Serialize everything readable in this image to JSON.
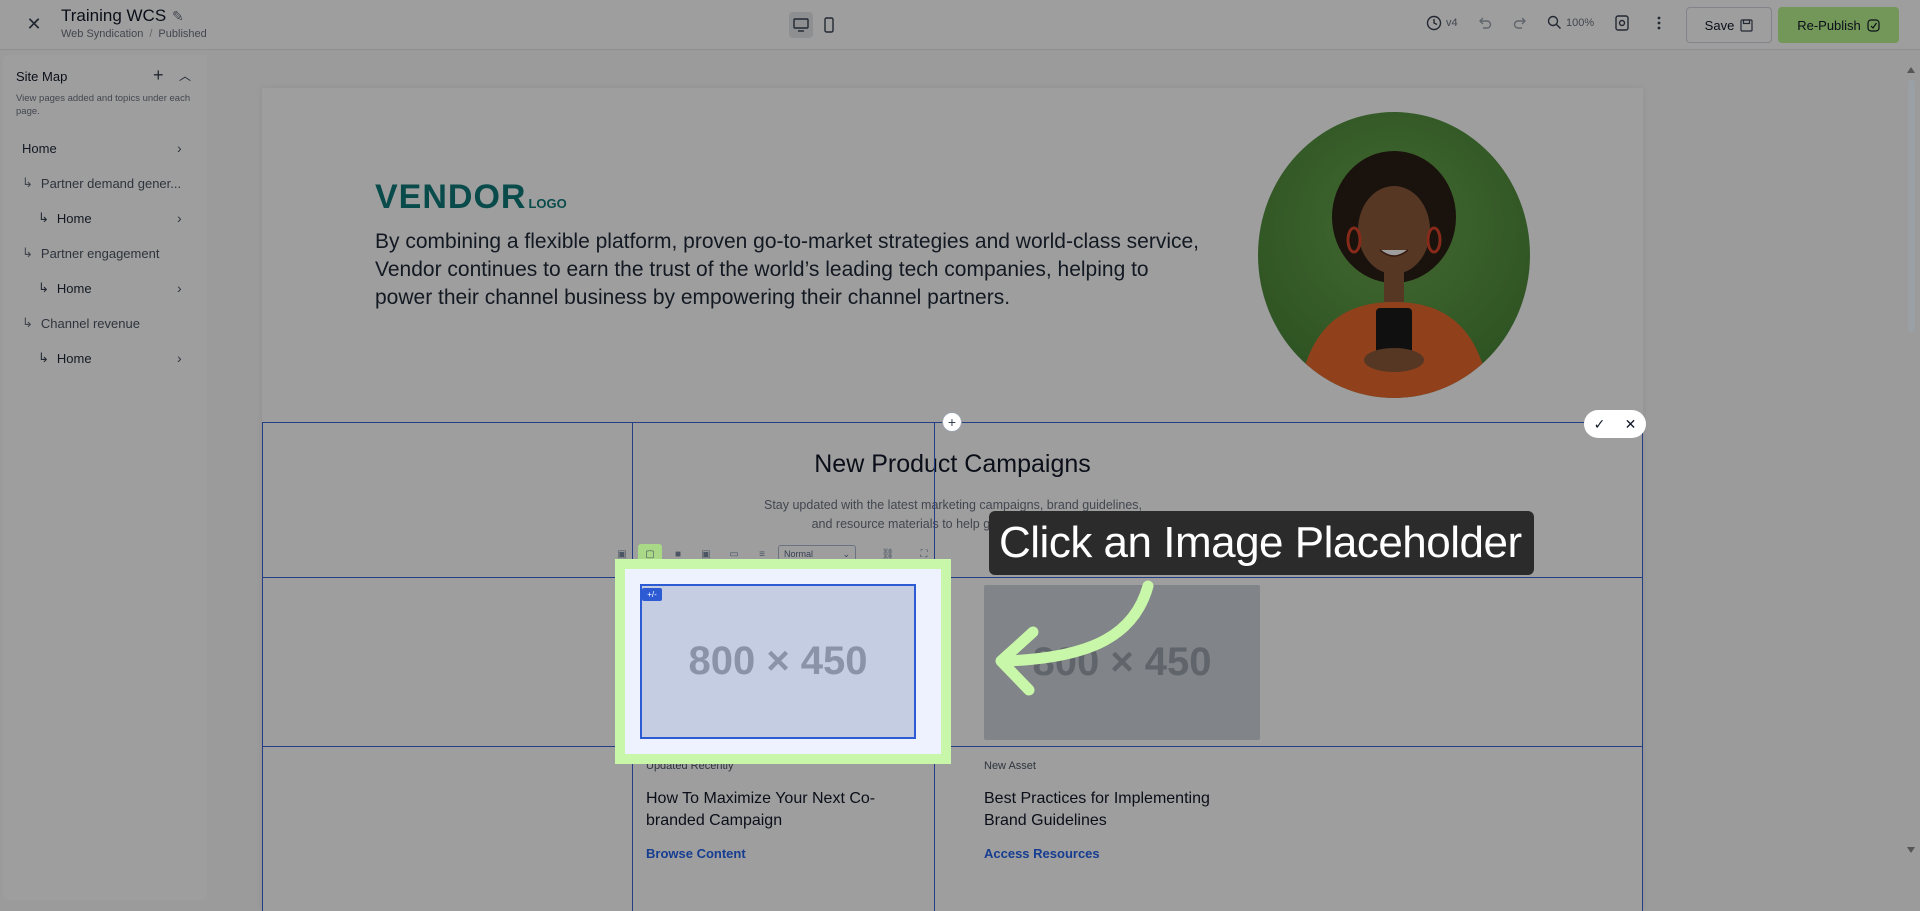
{
  "header": {
    "title": "Training WCS",
    "breadcrumb": [
      "Web Syndication",
      "Published"
    ],
    "version": "v4",
    "zoom": "100%",
    "save_label": "Save",
    "publish_label": "Re-Publish"
  },
  "sidebar": {
    "title": "Site Map",
    "description": "View pages added and topics under each page.",
    "items": [
      {
        "label": "Home",
        "level": 0,
        "arrow": true
      },
      {
        "label": "Partner demand gener...",
        "level": 1,
        "arrow": false
      },
      {
        "label": "Home",
        "level": 2,
        "arrow": true
      },
      {
        "label": "Partner engagement",
        "level": 1,
        "arrow": false
      },
      {
        "label": "Home",
        "level": 2,
        "arrow": true
      },
      {
        "label": "Channel revenue",
        "level": 1,
        "arrow": false
      },
      {
        "label": "Home",
        "level": 2,
        "arrow": true
      }
    ]
  },
  "hero": {
    "logo": "VENDOR",
    "logo_suffix": "LOGO",
    "text": "By combining a flexible platform, proven go-to-market strategies and world-class service, Vendor continues to earn the trust of the world’s leading tech companies, helping to power their channel business by empowering their channel partners."
  },
  "section": {
    "title": "New Product Campaigns",
    "subtitle": "Stay updated with the latest marketing campaigns, brand guidelines, and resource materials to help grow your business."
  },
  "toolbar": {
    "select_value": "Normal"
  },
  "cards": [
    {
      "placeholder": "800 × 450",
      "tag": "Updated Recently",
      "title": "How To Maximize Your Next Co-branded Campaign",
      "link": "Browse Content"
    },
    {
      "placeholder": "800 × 450",
      "tag": "New Asset",
      "title": "Best Practices for Implementing Brand Guidelines",
      "link": "Access Resources"
    }
  ],
  "focus": {
    "badge": "+/-"
  },
  "callout": {
    "text": "Click an Image Placeholder"
  },
  "colors": {
    "accent_green": "#b8f48f",
    "highlight_green": "#c9f7a9",
    "selection_blue": "#2d5bd3",
    "logo_teal": "#107a7a"
  }
}
